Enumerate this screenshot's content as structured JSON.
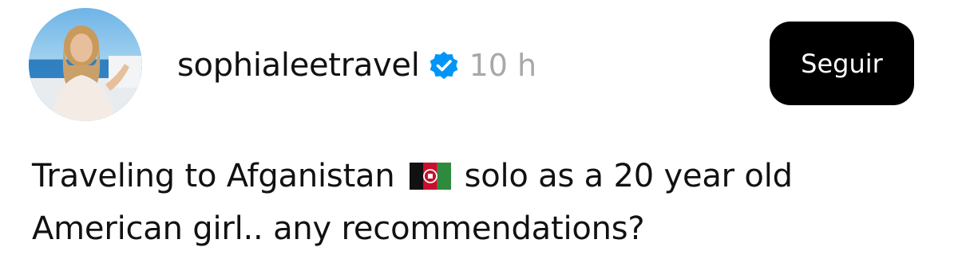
{
  "post": {
    "username": "sophialeetravel",
    "verified_icon": "verified-badge-icon",
    "time": "10 h",
    "follow_label": "Seguir",
    "text_line1_before_flag": "Traveling to Afganistan",
    "flag_icon": "afghanistan-flag-icon",
    "text_line1_after_flag": "solo as a 20 year old",
    "text_line2": "American girl.. any recommendations?"
  },
  "colors": {
    "verified": "#0095f6",
    "time": "#a8a8a8",
    "button_bg": "#000000",
    "button_text": "#ffffff"
  }
}
